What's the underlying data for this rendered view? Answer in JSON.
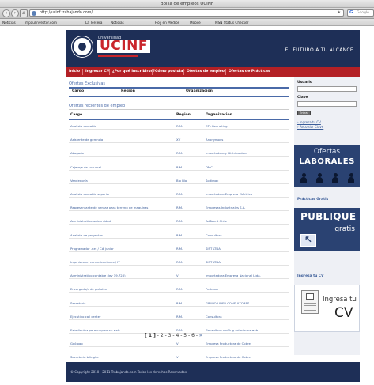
{
  "window": {
    "title": "Bolsa de empleos UCINF"
  },
  "toolbar": {
    "url": "http://ucinf.trabajando.com/",
    "search_engine": "Google",
    "search_initial": "G"
  },
  "bookmarks": [
    "Noticias",
    "mpaulinvestor.com",
    "La Tercera",
    "Noticias",
    "Hoy en Medios",
    "Mobile",
    "MSN Status Checker"
  ],
  "banner": {
    "logo_small": "universidad",
    "logo_big": "UCINF",
    "tagline": "EL FUTURO A TU ALCANCE"
  },
  "menu": [
    "Inicio",
    "Ingresar CV",
    "¿Por qué inscribirse?",
    "Cómo postular",
    "Ofertas de empleo",
    "Ofertas de Prácticas"
  ],
  "exclusive": {
    "title": "Ofertas Exclusivas",
    "headers": [
      "Cargo",
      "Región",
      "Organización"
    ]
  },
  "offers": {
    "title": "Ofertas recientes de empleo",
    "headers": [
      "Cargo",
      "Región",
      "Organización"
    ],
    "rows": [
      [
        "Analista contable",
        "R.M.",
        "CPL Recruiting"
      ],
      [
        "Asistente de gerencia",
        "XV",
        "Anonymous"
      ],
      [
        "Abogado",
        "R.M.",
        "Importadora y Distribuidora"
      ],
      [
        "Cajero/a de sucursal",
        "R.M.",
        "DMC"
      ],
      [
        "Vendedor/a",
        "Bío Bío",
        "Sodimac"
      ],
      [
        "Analista contable superior",
        "R.M.",
        "Importadora Empresa Eléctrica"
      ],
      [
        "Representante de ventas para terreno de maquinas",
        "R.M.",
        "Empresas Industriales S.A."
      ],
      [
        "Administrativo universidad",
        "R.M.",
        "AdTalent Chile"
      ],
      [
        "Analista de proyectos",
        "R.M.",
        "Consultora"
      ],
      [
        "Programador .net / C# junior",
        "R.M.",
        "SIST LTDA."
      ],
      [
        "Ingeniero en comunicaciones / IT",
        "R.M.",
        "SIST LTDA."
      ],
      [
        "Administrativo contable (ley 19.728)",
        "VI",
        "Importadora Empresa Nacional Ltda."
      ],
      [
        "Encargado/a de pañoles",
        "R.M.",
        "Pedrosur"
      ],
      [
        "Secretaria",
        "R.M.",
        "GRUPO LIDER CONSULTORES"
      ],
      [
        "Ejecutivo call center",
        "R.M.",
        "Consultora"
      ],
      [
        "Estudiantes para empleo en web",
        "R.M.",
        "Consultora staffing soluciones web"
      ],
      [
        "Geólogo",
        "VI",
        "Empresa Productora de Cobre"
      ],
      [
        "Secretaria bilingüe",
        "VI",
        "Empresa Productora de Cobre"
      ]
    ]
  },
  "pagination": {
    "current": "[ 1 ]",
    "pages": [
      "2",
      "3",
      "4",
      "5",
      "6"
    ],
    "separator": " - ",
    "next_symbol": "»"
  },
  "sidebar": {
    "user_label": "Usuario",
    "password_label": "Clave",
    "login_button": "Entrar",
    "link_register": "Ingresa tu CV",
    "link_forgot": "Recordar Clave",
    "ofertas_line1": "Ofertas",
    "ofertas_line2": "LABORALES",
    "practicas_label": "Prácticas Gratis",
    "publique_line1": "PUBLIQUE",
    "publique_line2": "gratis",
    "ingresa_label": "Ingresa tu CV",
    "ingresa_line1": "Ingresa tu",
    "ingresa_line2": "CV"
  },
  "footer": {
    "text": "© Copyright 2010 - 2011 Trabajando.com Todos los derechos Reservados"
  },
  "colors": {
    "navy": "#1e2f57",
    "red": "#b32025",
    "link": "#3b5d99"
  }
}
